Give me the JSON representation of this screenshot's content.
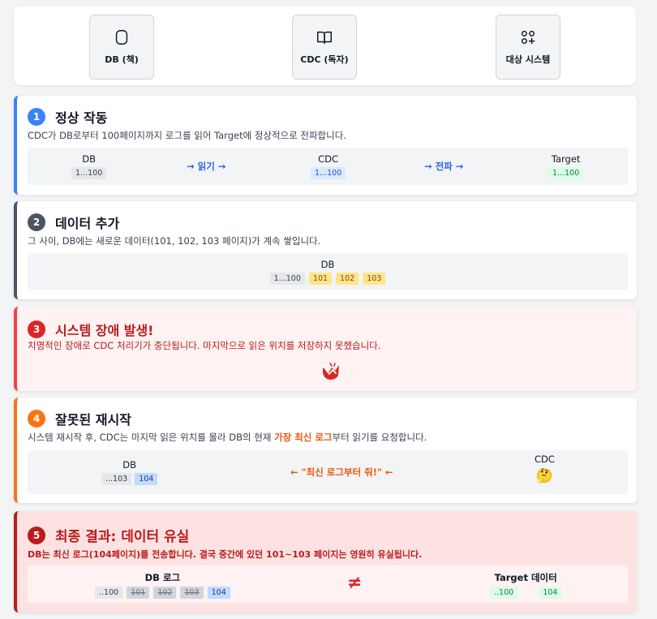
{
  "legend": [
    {
      "label": "DB (책)",
      "icon": "database-icon"
    },
    {
      "label": "CDC (독자)",
      "icon": "book-icon"
    },
    {
      "label": "대상 시스템",
      "icon": "apps-icon"
    }
  ],
  "steps": {
    "s1": {
      "number": "1",
      "title": "정상 작동",
      "desc": "CDC가 DB로부터 100페이지까지 로그를 읽어 Target에 정상적으로 전파합니다.",
      "db_label": "DB",
      "db_range": "1...100",
      "arrow1": "→ 읽기 →",
      "cdc_label": "CDC",
      "cdc_range": "1...100",
      "arrow2": "→ 전파 →",
      "target_label": "Target",
      "target_range": "1...100"
    },
    "s2": {
      "number": "2",
      "title": "데이터 추가",
      "desc": "그 사이, DB에는 새로운 데이터(101, 102, 103 페이지)가 계속 쌓입니다.",
      "db_label": "DB",
      "pages": [
        "1...100",
        "101",
        "102",
        "103"
      ]
    },
    "s3": {
      "number": "3",
      "title": "시스템 장애 발생!",
      "desc": "치명적인 장애로 CDC 처리기가 중단됩니다. 마지막으로 읽은 위치를 저장하지 못했습니다.",
      "icon": "crash-icon"
    },
    "s4": {
      "number": "4",
      "title": "잘못된 재시작",
      "desc_pre": "시스템 재시작 후, CDC는 마지막 읽은 위치를 몰라 DB의 현재 ",
      "desc_highlight": "가장 최신 로그",
      "desc_post": "부터 읽기를 요청합니다.",
      "db_label": "DB",
      "db_pages": [
        "...103",
        "104"
      ],
      "arrow": "← \"최신 로그부터 줘!\" ←",
      "cdc_label": "CDC",
      "cdc_emoji": "🤔"
    },
    "s5": {
      "number": "5",
      "title": "최종 결과: 데이터 유실",
      "desc": "DB는 최신 로그(104페이지)를 전송합니다. 결국 중간에 있던 101~103 페이지는 영원히 유실됩니다.",
      "log_label": "DB 로그",
      "log_pages": [
        "..100",
        "101",
        "102",
        "103",
        "104"
      ],
      "neq": "≠",
      "target_label": "Target 데이터",
      "target_pages": [
        "..100",
        "104"
      ]
    }
  },
  "colors": {
    "s1": "#3b82f6",
    "s2": "#4b5563",
    "s3": "#ef4444",
    "s4": "#f97316",
    "s5": "#b91c1c"
  }
}
